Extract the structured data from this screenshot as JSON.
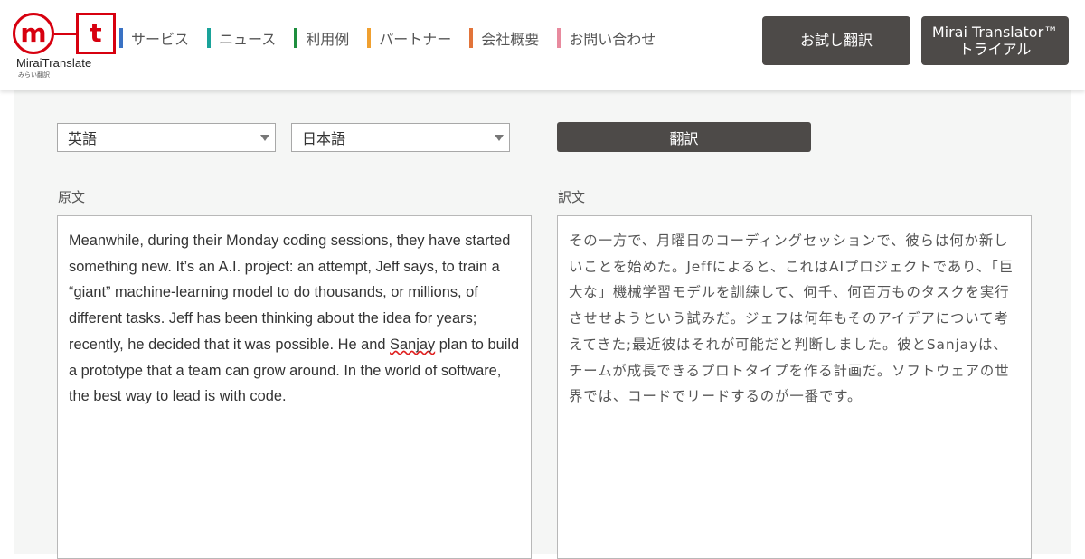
{
  "header": {
    "logo": {
      "letter_m": "m",
      "letter_t": "t",
      "name": "MiraiTranslate",
      "sub": "みらい翻訳"
    },
    "nav": [
      {
        "label": "サービス",
        "color": "#3a72c4"
      },
      {
        "label": "ニュース",
        "color": "#1aa39a"
      },
      {
        "label": "利用例",
        "color": "#1e8e3e"
      },
      {
        "label": "パートナー",
        "color": "#f0a030"
      },
      {
        "label": "会社概要",
        "color": "#e2743a"
      },
      {
        "label": "お問い合わせ",
        "color": "#e88a9e"
      }
    ],
    "trial_button": "お試し翻訳",
    "translator_button_line1": "Mirai Translator™",
    "translator_button_line2": "トライアル"
  },
  "controls": {
    "source_language": "英語",
    "target_language": "日本語",
    "translate_button": "翻訳"
  },
  "source": {
    "label": "原文",
    "text_before": "Meanwhile, during their Monday coding sessions, they have started something new. It’s an A.I. project: an attempt, Jeff says, to train a “giant” machine-learning model to do thousands, or millions, of different tasks. Jeff has been thinking about the idea for years; recently, he decided that it was possible. He and ",
    "misspelled_word": "Sanjay",
    "text_after": " plan to build a prototype that a team can grow around. In the world of software, the best way to lead is with code."
  },
  "target": {
    "label": "訳文",
    "text": "その一方で、月曜日のコーディングセッションで、彼らは何か新しいことを始めた。Jeffによると、これはAIプロジェクトであり、「巨大な」機械学習モデルを訓練して、何千、何百万ものタスクを実行させせようという試みだ。ジェフは何年もそのアイデアについて考えてきた;最近彼はそれが可能だと判断しました。彼とSanjayは、チームが成長できるプロトタイプを作る計画だ。ソフトウェアの世界では、コードでリードするのが一番です。"
  },
  "colors": {
    "brand_red": "#d7000f",
    "dark_button": "#4d4a48",
    "panel_background": "#f5f6f5"
  }
}
